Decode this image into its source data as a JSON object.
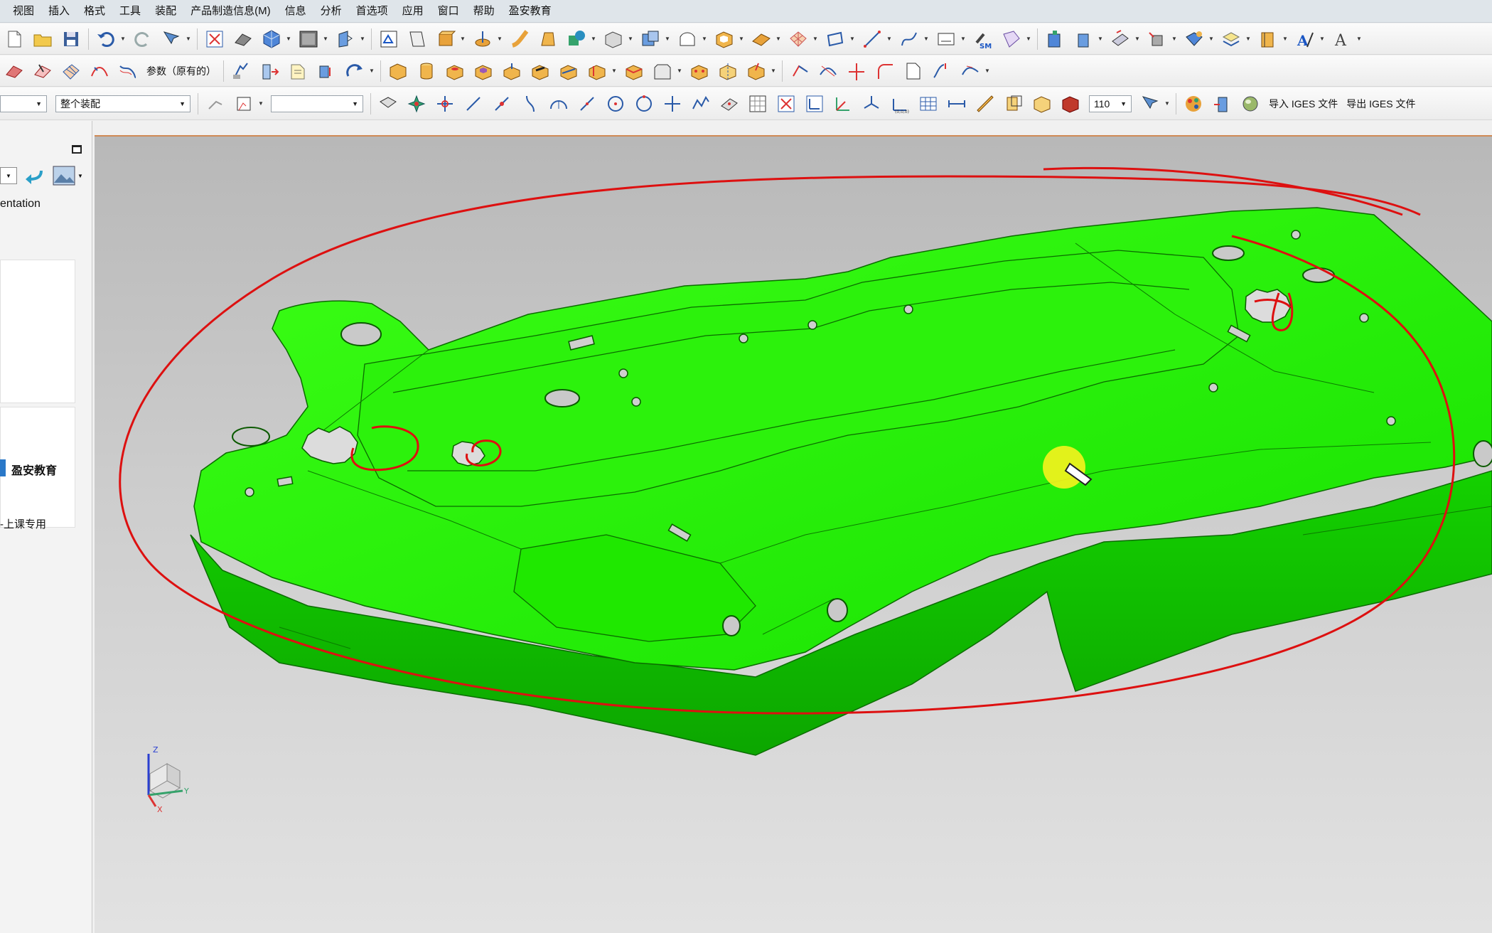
{
  "menu": [
    "视图",
    "插入",
    "格式",
    "工具",
    "装配",
    "产品制造信息(M)",
    "信息",
    "分析",
    "首选项",
    "应用",
    "窗口",
    "帮助",
    "盈安教育"
  ],
  "toolbar2": {
    "param_label": "参数（原有的）"
  },
  "toolbar3": {
    "selection_scope": "整个装配",
    "zoom_value": "110",
    "import_iges": "导入 IGES 文件",
    "export_iges": "导出 IGES 文件"
  },
  "left_panel": {
    "orientation_label": "entation",
    "brand_label": "盈安教育",
    "course_label": "-上课专用"
  },
  "viewport": {
    "part_color": "#22ee00",
    "annotation_color": "#dd1010",
    "cursor_highlight_color": "#f7f31e",
    "triad_axes": [
      "Z",
      "Y",
      "X"
    ]
  },
  "colors": {
    "menubar": "#dfe5ea",
    "panel_accent": "#2a78c8"
  }
}
